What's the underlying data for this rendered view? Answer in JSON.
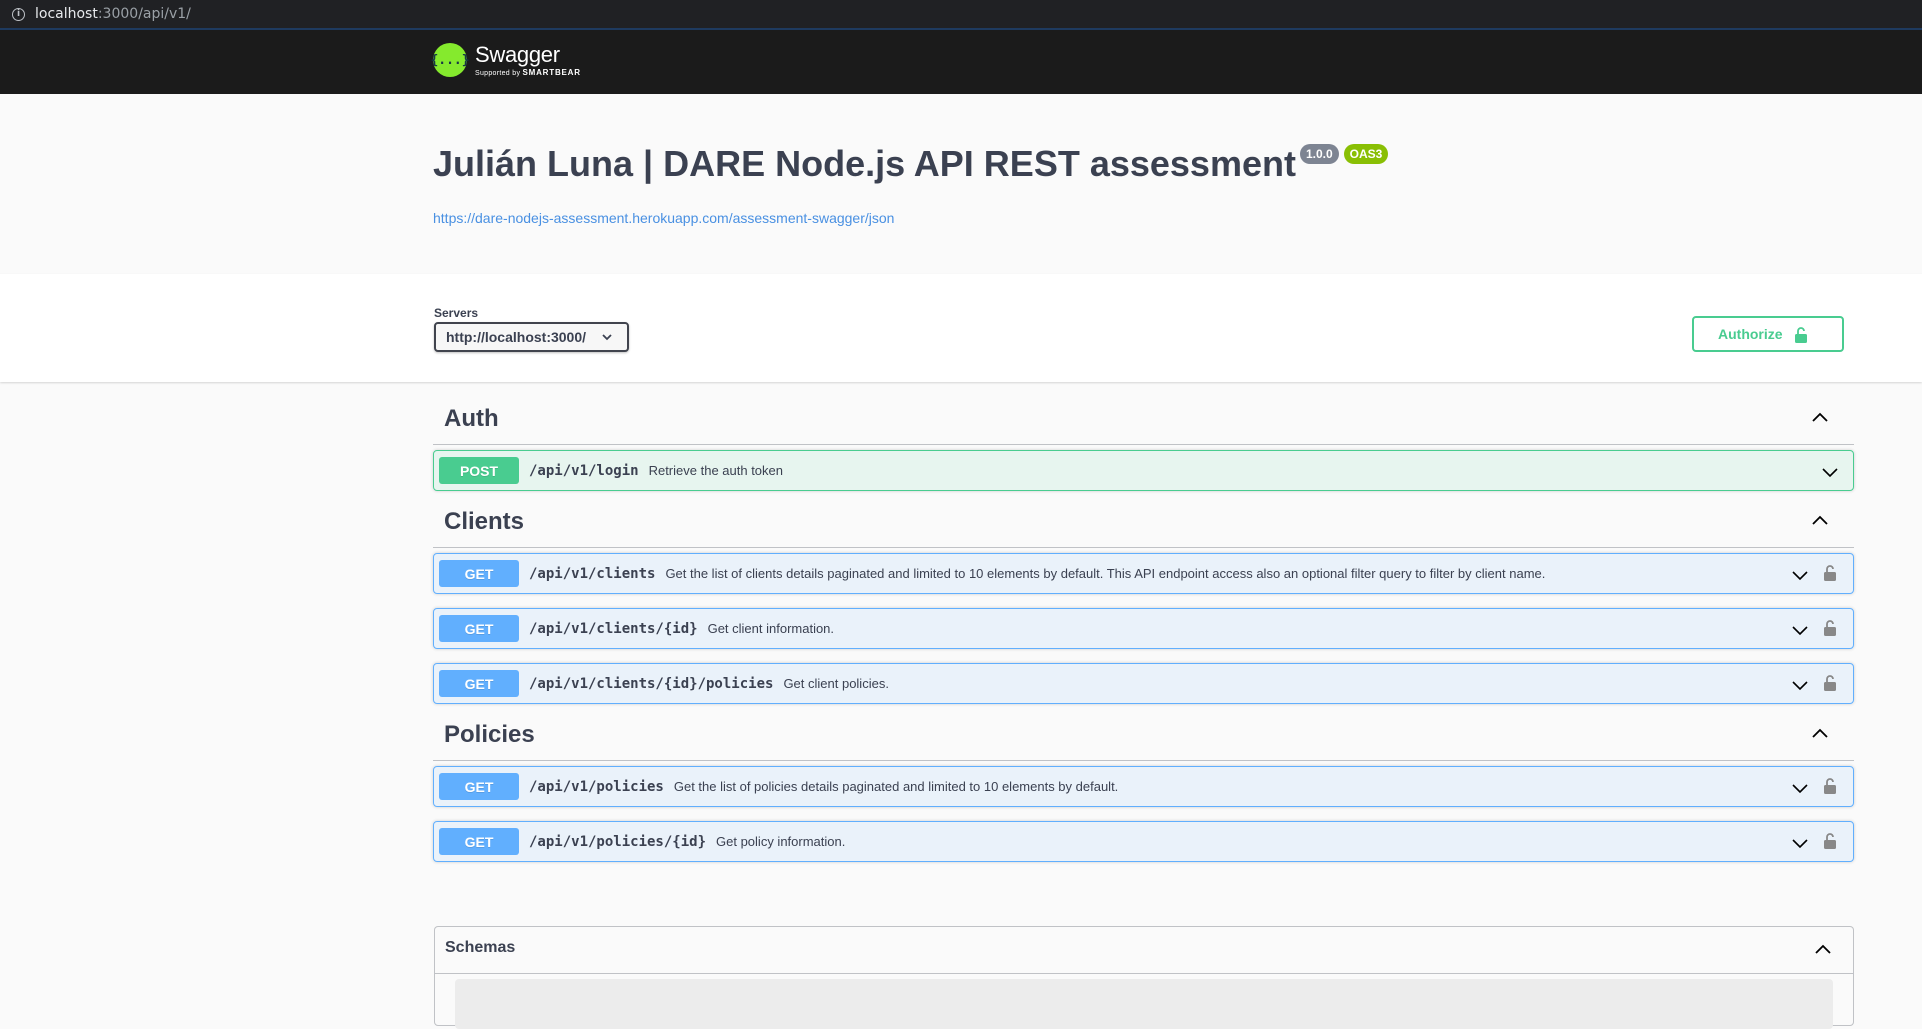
{
  "browser": {
    "url_host": "localhost",
    "url_rest": ":3000/api/v1/"
  },
  "topbar": {
    "logo_glyph": "{...}",
    "logo_name": "Swagger",
    "logo_supported": "Supported by",
    "logo_company": "SMARTBEAR"
  },
  "info": {
    "title": "Julián Luna | DARE Node.js API REST assessment",
    "version": "1.0.0",
    "oas_badge": "OAS3",
    "spec_url": "https://dare-nodejs-assessment.herokuapp.com/assessment-swagger/json"
  },
  "scheme": {
    "servers_label": "Servers",
    "selected_server": "http://localhost:3000/",
    "authorize_label": "Authorize"
  },
  "sections": [
    {
      "name": "Auth",
      "operations": [
        {
          "method": "POST",
          "path": "/api/v1/login",
          "summary": "Retrieve the auth token",
          "locked": false
        }
      ]
    },
    {
      "name": "Clients",
      "operations": [
        {
          "method": "GET",
          "path": "/api/v1/clients",
          "summary": "Get the list of clients details paginated and limited to 10 elements by default. This API endpoint access also an optional filter query to filter by client name.",
          "locked": true
        },
        {
          "method": "GET",
          "path": "/api/v1/clients/{id}",
          "summary": "Get client information.",
          "locked": true
        },
        {
          "method": "GET",
          "path": "/api/v1/clients/{id}/policies",
          "summary": "Get client policies.",
          "locked": true
        }
      ]
    },
    {
      "name": "Policies",
      "operations": [
        {
          "method": "GET",
          "path": "/api/v1/policies",
          "summary": "Get the list of policies details paginated and limited to 10 elements by default.",
          "locked": true
        },
        {
          "method": "GET",
          "path": "/api/v1/policies/{id}",
          "summary": "Get policy information.",
          "locked": true
        }
      ]
    }
  ],
  "schemas": {
    "title": "Schemas"
  },
  "colors": {
    "post": "#49cc90",
    "get": "#61affe",
    "topbar": "#1b1b1b",
    "logo": "#85ea2d",
    "link": "#4990e2"
  },
  "icons": [
    "info-icon",
    "swagger-logo-icon",
    "chevron-down-icon",
    "chevron-up-icon",
    "lock-icon",
    "unlock-icon"
  ]
}
